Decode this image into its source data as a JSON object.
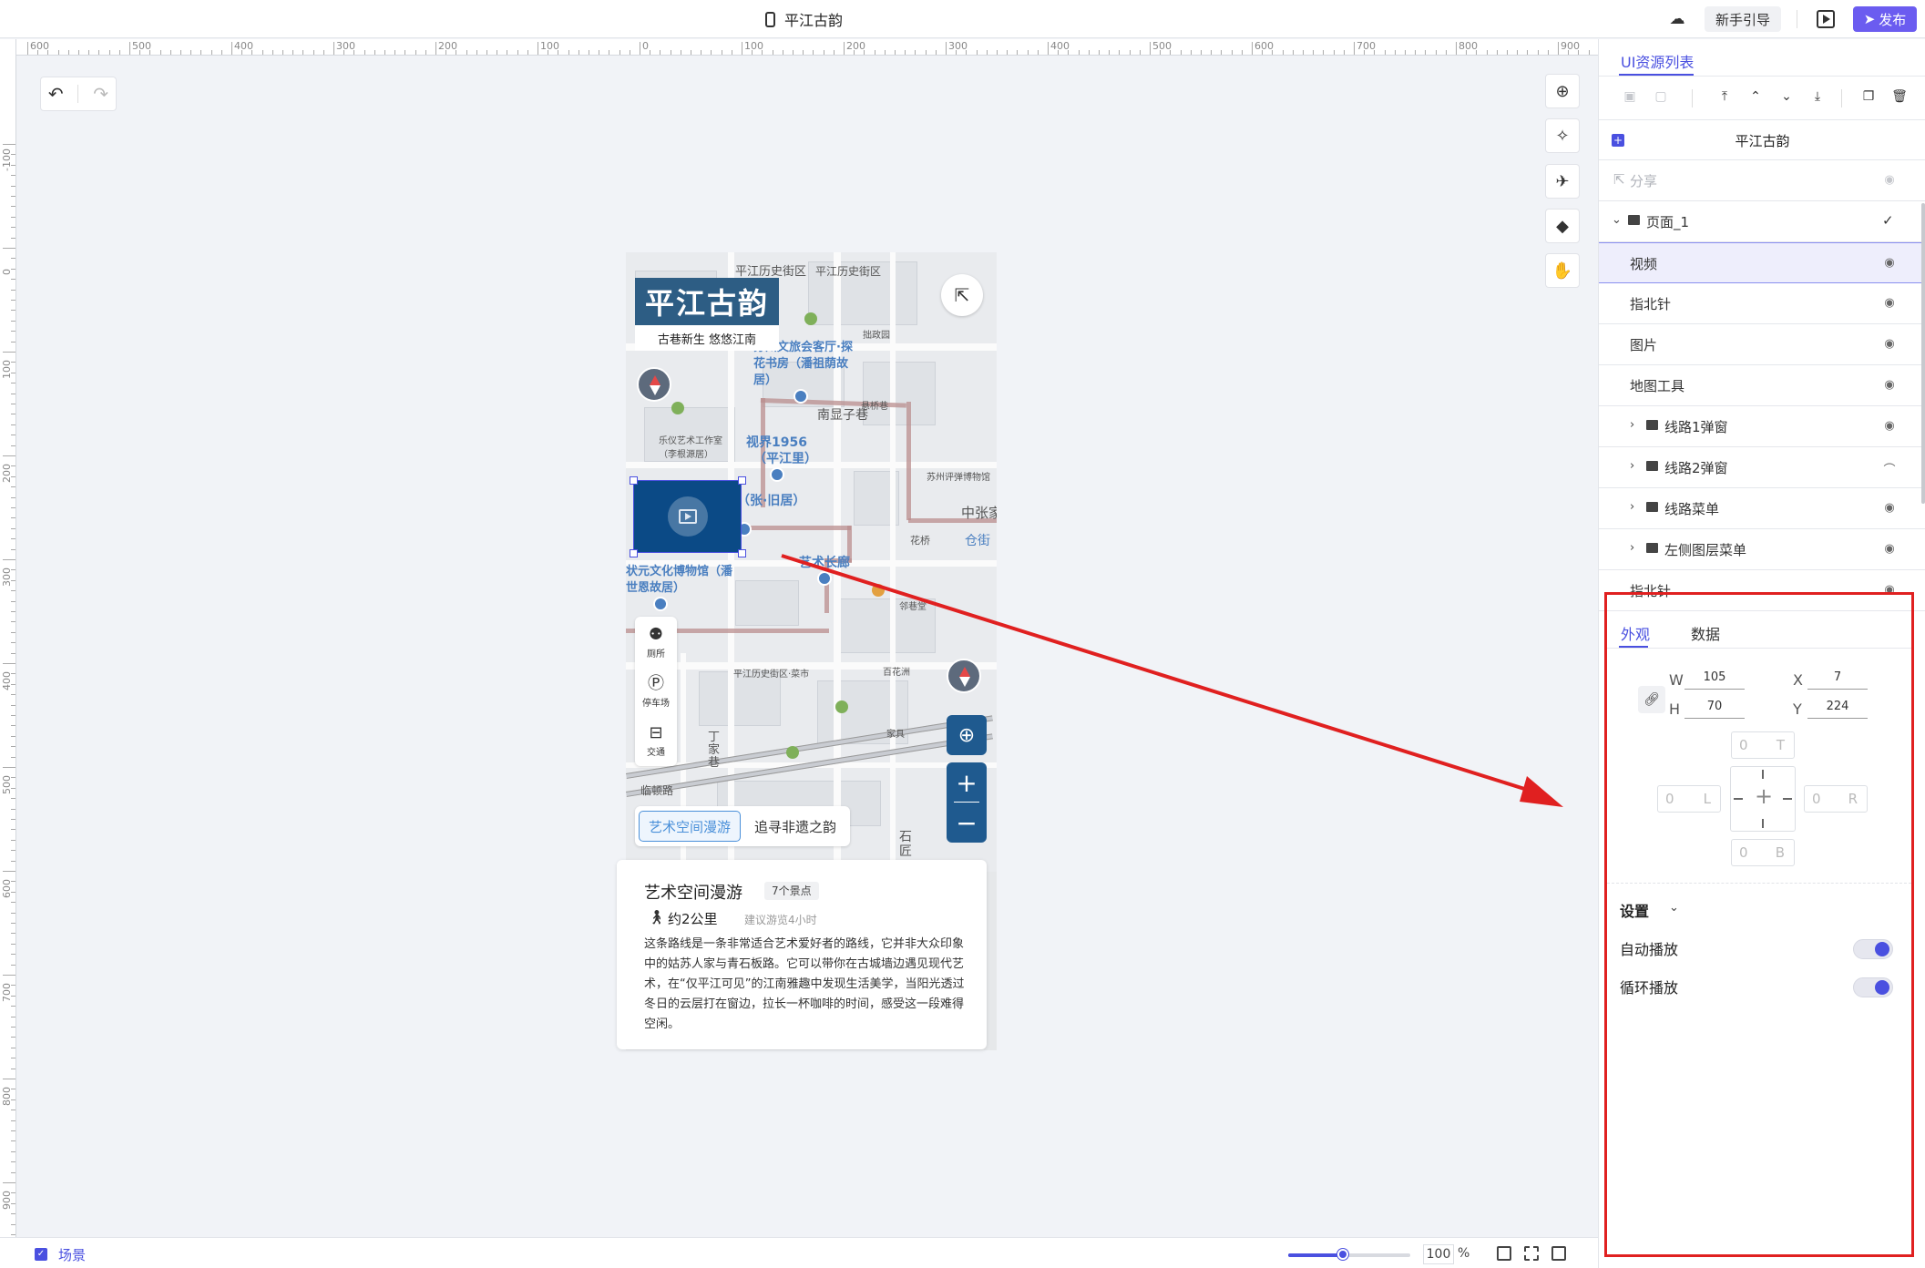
{
  "header": {
    "title": "平江古韵",
    "guide_label": "新手引导",
    "publish_label": "发布",
    "icons": [
      "phone-icon",
      "cloud-sync-icon",
      "play-icon",
      "send-icon"
    ]
  },
  "rulers": {
    "top_labels": [
      "600",
      "500",
      "400",
      "300",
      "200",
      "100",
      "0",
      "100",
      "200",
      "300",
      "400",
      "500",
      "600",
      "700",
      "800",
      "900"
    ],
    "left_labels": [
      "-100",
      "0",
      "100",
      "200",
      "300",
      "400",
      "500",
      "600",
      "700",
      "800",
      "900"
    ]
  },
  "canvas": {
    "logo_title": "平江古韵",
    "logo_subtitle": "古巷新生  悠悠江南",
    "map_labels": [
      "平江历史街区",
      "苏州文旅会客厅·探花书房（潘祖荫故居）",
      "南显子巷",
      "视界1956（平江里）",
      "（张·旧居）",
      "状元文化博物馆（潘世恩故居）",
      "中张家巷",
      "苏州评弹博物馆",
      "乐仪艺术工作室（李根源居）",
      "艺术长廊",
      "平江历史街区·菜市",
      "丁家巷",
      "临顿路",
      "石匠",
      "百花洲",
      "仓街",
      "家具",
      "悬桥巷",
      "花桥",
      "拙政园",
      "邻巷堂"
    ],
    "map_route_labels": [
      "视界1956",
      "（平江里）",
      "艺术长廊"
    ],
    "tools": [
      {
        "label": "厕所",
        "icon": "toilet-icon"
      },
      {
        "label": "停车场",
        "icon": "parking-icon"
      },
      {
        "label": "交通",
        "icon": "bus-icon"
      }
    ],
    "route_tabs": [
      {
        "label": "艺术空间漫游",
        "active": true
      },
      {
        "label": "追寻非遗之韵",
        "active": false
      }
    ],
    "info_card": {
      "title": "艺术空间漫游",
      "badge": "7个景点",
      "distance": "约2公里",
      "tip": "建议游览4小时",
      "description": "这条路线是一条非常适合艺术爱好者的路线，它并非大众印象中的姑苏人家与青石板路。它可以带你在古城墙边遇见现代艺术，在“仅平江可见”的江南雅趣中发现生活美学，当阳光透过冬日的云层打在窗边，拉长一杯咖啡的时间，感受这一段难得空闲。"
    }
  },
  "right_panel": {
    "tab_label": "UI资源列表",
    "project_name": "平江古韵",
    "share_label": "分享",
    "layers": [
      {
        "label": "页面_1",
        "type": "page"
      },
      {
        "label": "视频",
        "type": "item",
        "selected": true
      },
      {
        "label": "指北针",
        "type": "item"
      },
      {
        "label": "图片",
        "type": "item"
      },
      {
        "label": "地图工具",
        "type": "item"
      },
      {
        "label": "线路1弹窗",
        "type": "folder",
        "hidden": false
      },
      {
        "label": "线路2弹窗",
        "type": "folder",
        "hidden": true
      },
      {
        "label": "线路菜单",
        "type": "folder",
        "hidden": false
      },
      {
        "label": "左侧图层菜单",
        "type": "folder",
        "hidden": false
      },
      {
        "label": "指北针",
        "type": "item"
      }
    ]
  },
  "properties": {
    "tabs": [
      {
        "label": "外观",
        "active": true
      },
      {
        "label": "数据",
        "active": false
      }
    ],
    "w_label": "W",
    "w_value": "105",
    "h_label": "H",
    "h_value": "70",
    "x_label": "X",
    "x_value": "7",
    "y_label": "Y",
    "y_value": "224",
    "margin": {
      "top": {
        "value": "0",
        "side": "T"
      },
      "left": {
        "value": "0",
        "side": "L"
      },
      "right": {
        "value": "0",
        "side": "R"
      },
      "bottom": {
        "value": "0",
        "side": "B"
      }
    },
    "settings_title": "设置",
    "autoplay_label": "自动播放",
    "autoplay_on": true,
    "loop_label": "循环播放",
    "loop_on": true
  },
  "bottombar": {
    "scene_label": "场景",
    "zoom_value": "100",
    "zoom_unit": "%",
    "zoom_fraction": 0.45
  },
  "colors": {
    "accent": "#4a50e0",
    "publish": "#6b5cf0",
    "annotation_red": "#e02020",
    "video_bg": "#0b4a86"
  }
}
